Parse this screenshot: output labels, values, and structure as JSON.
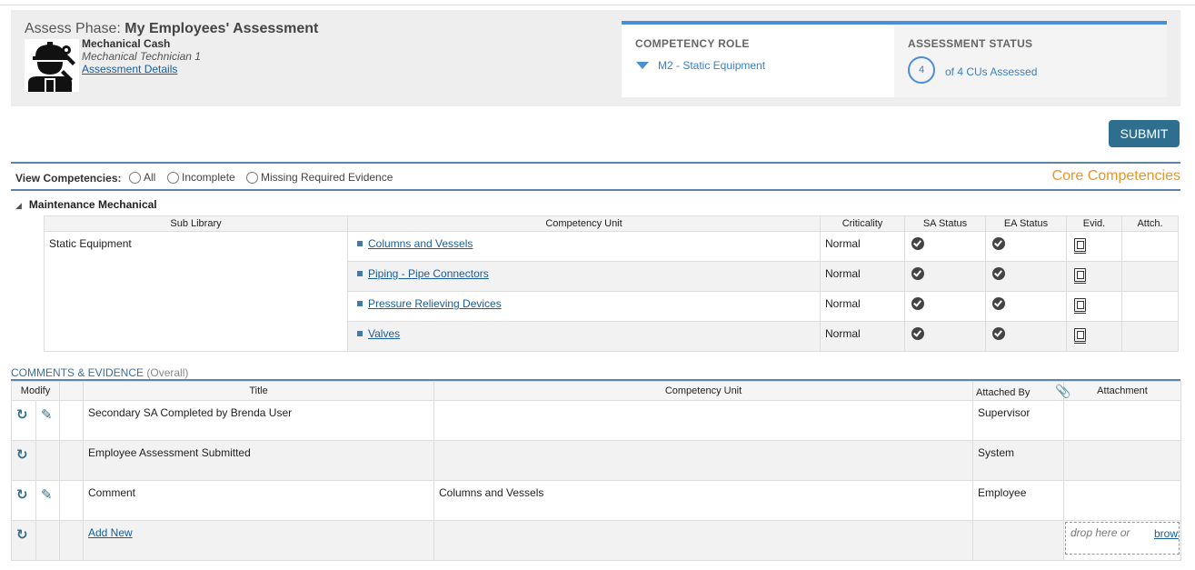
{
  "header": {
    "phase_prefix": "Assess Phase:",
    "phase_name": "My Employees' Assessment",
    "employee_name": "Mechanical Cash",
    "employee_role": "Mechanical Technician 1",
    "details_link": "Assessment Details"
  },
  "status": {
    "competency_role_label": "COMPETENCY ROLE",
    "competency_role_value": "M2 - Static Equipment",
    "assessment_status_label": "ASSESSMENT STATUS",
    "assessed_count": "4",
    "assessed_text": "of 4 CUs Assessed"
  },
  "actions": {
    "submit_label": "SUBMIT"
  },
  "filter": {
    "label": "View Competencies:",
    "options": [
      "All",
      "Incomplete",
      "Missing Required Evidence"
    ],
    "core_label": "Core Competencies"
  },
  "section": {
    "title": "Maintenance Mechanical"
  },
  "competency_table": {
    "headers": [
      "Sub Library",
      "Competency Unit",
      "Criticality",
      "SA Status",
      "EA Status",
      "Evid.",
      "Attch."
    ],
    "sub_library": "Static Equipment",
    "rows": [
      {
        "unit": "Columns and Vessels",
        "criticality": "Normal"
      },
      {
        "unit": "Piping - Pipe Connectors",
        "criticality": "Normal"
      },
      {
        "unit": "Pressure Relieving Devices",
        "criticality": "Normal"
      },
      {
        "unit": "Valves",
        "criticality": "Normal"
      }
    ]
  },
  "comments": {
    "title": "COMMENTS & EVIDENCE",
    "title_suffix": "(Overall)",
    "headers": [
      "Modify",
      "Title",
      "Competency Unit",
      "Attached By",
      "Attachment"
    ],
    "rows": [
      {
        "title": "Secondary SA Completed by Brenda User",
        "unit": "",
        "attached_by": "Supervisor"
      },
      {
        "title": "Employee Assessment Submitted",
        "unit": "",
        "attached_by": "System"
      },
      {
        "title": "Comment",
        "unit": "Columns and Vessels",
        "attached_by": "Employee"
      }
    ],
    "add_new": "Add New",
    "drop_text": "drop here or",
    "browse_text": "brows"
  },
  "colors": {
    "accent": "#4a8fd6",
    "button": "#2e6f8f",
    "core": "#e8952a",
    "rule": "#5d86a6"
  }
}
